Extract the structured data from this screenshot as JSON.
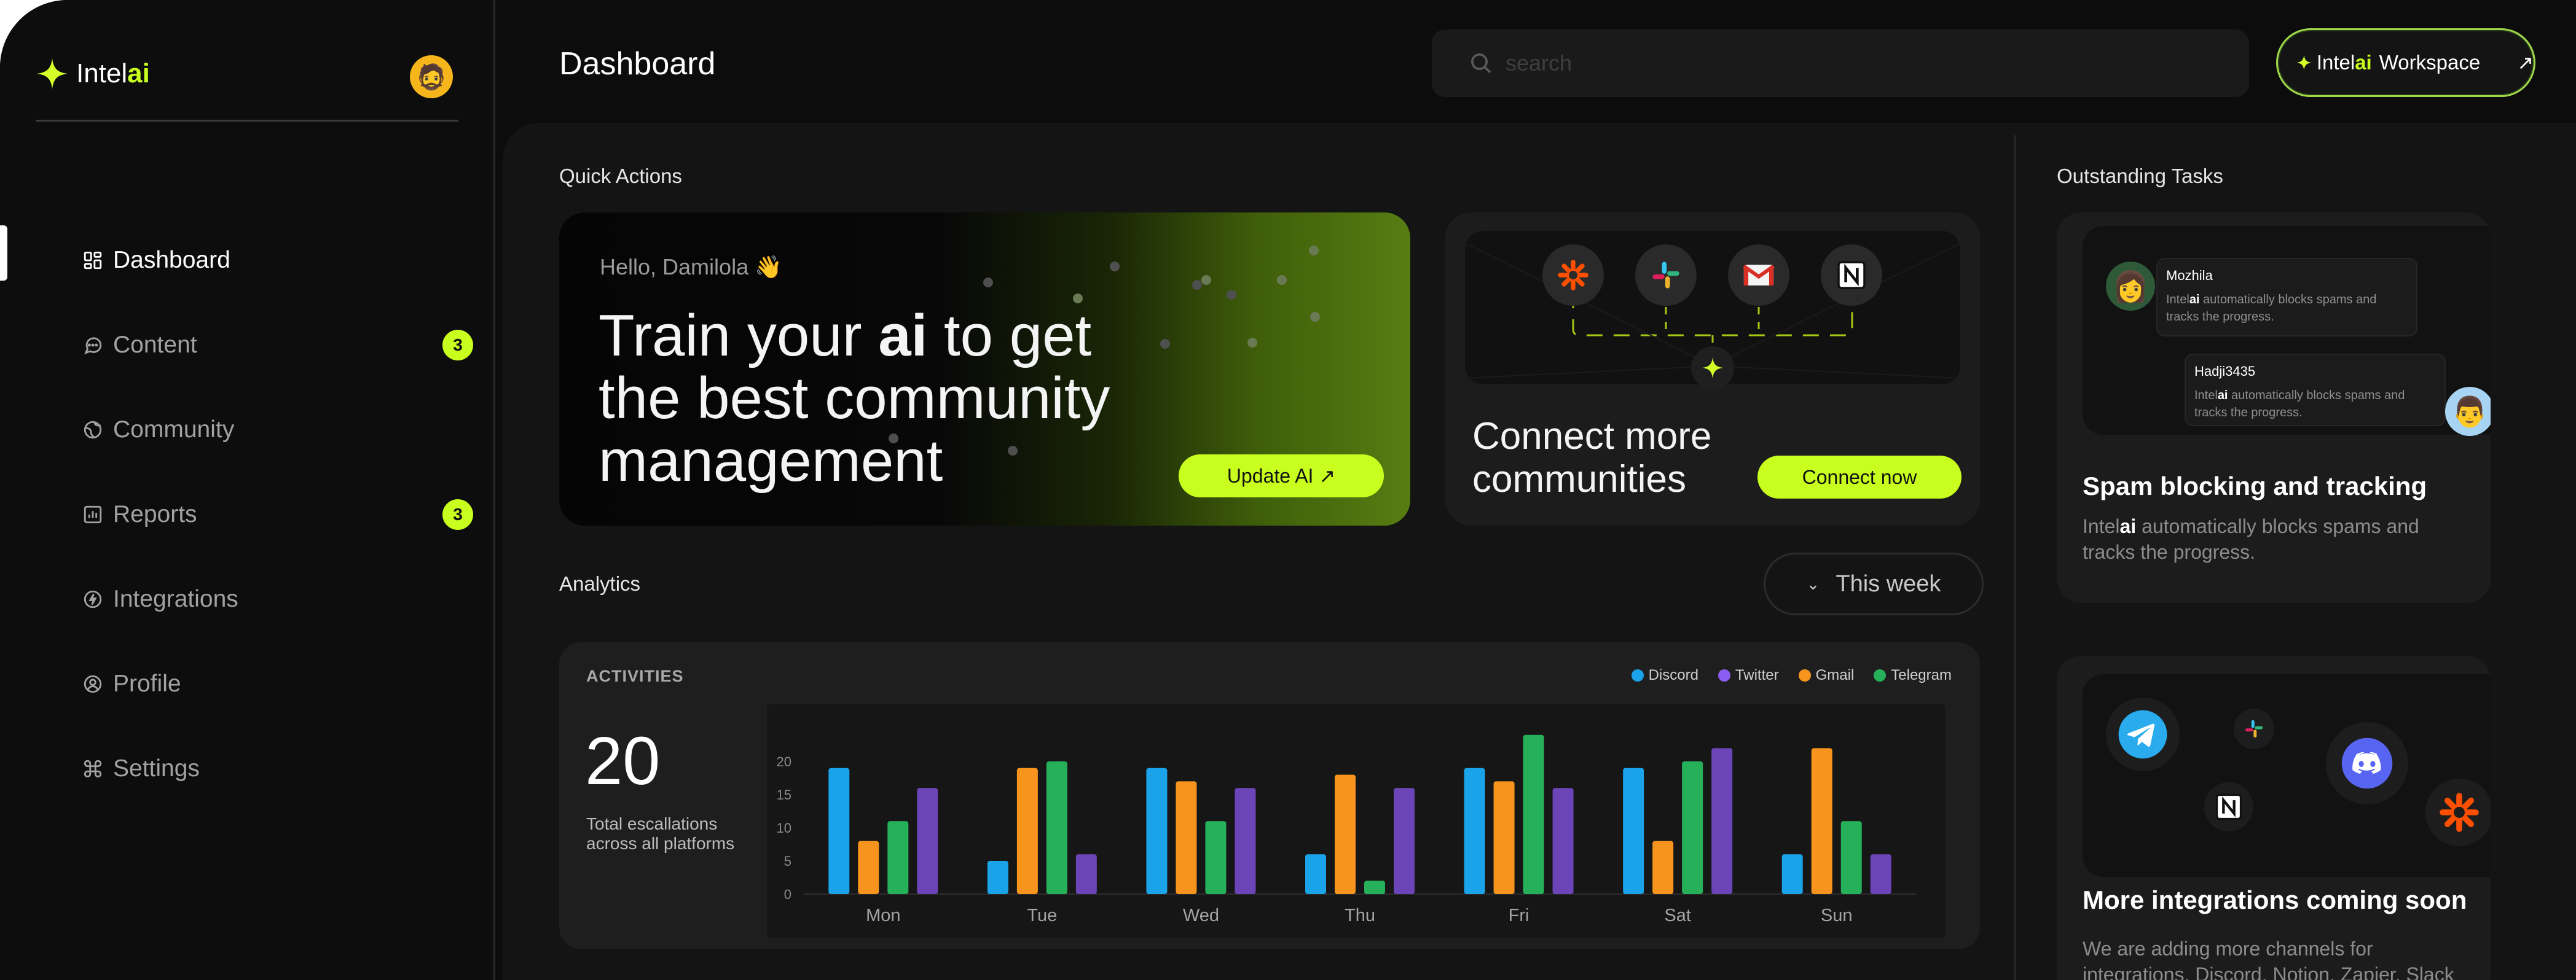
{
  "app": {
    "name_prefix": "Intel",
    "name_suffix": "ai"
  },
  "header": {
    "title": "Dashboard",
    "search_placeholder": "search",
    "workspace": {
      "prefix": "Intel",
      "suffix": "ai",
      "label": "Workspace",
      "arrow": "↗"
    }
  },
  "sidebar": {
    "items": [
      {
        "label": "Dashboard",
        "icon": "grid-icon",
        "active": true
      },
      {
        "label": "Content",
        "icon": "chat-icon",
        "badge": "3"
      },
      {
        "label": "Community",
        "icon": "globe-icon"
      },
      {
        "label": "Reports",
        "icon": "bar-chart-icon",
        "badge": "3"
      },
      {
        "label": "Integrations",
        "icon": "bolt-icon"
      },
      {
        "label": "Profile",
        "icon": "user-icon"
      },
      {
        "label": "Settings",
        "icon": "command-icon"
      }
    ]
  },
  "quick_actions": {
    "title": "Quick Actions",
    "hero": {
      "greeting": "Hello, Damilola 👋",
      "line1_pre": "Train your ",
      "line1_bold": "ai",
      "line1_post": " to get",
      "line2": "the best community",
      "line3": "management",
      "button": "Update AI ↗"
    },
    "connect": {
      "title_line1": "Connect more",
      "title_line2": "communities",
      "button": "Connect now",
      "apps": [
        "zapier-icon",
        "slack-icon",
        "gmail-icon",
        "notion-icon"
      ]
    }
  },
  "analytics": {
    "title": "Analytics",
    "period": "This week",
    "card_label": "ACTIVITIES",
    "total": "20",
    "total_desc": "Total escallations across all platforms"
  },
  "chart_data": {
    "type": "bar",
    "categories": [
      "Mon",
      "Tue",
      "Wed",
      "Thu",
      "Fri",
      "Sat",
      "Sun"
    ],
    "series": [
      {
        "name": "Discord",
        "color": "#1aa3e8",
        "values": [
          19,
          5,
          19,
          6,
          19,
          19,
          6
        ]
      },
      {
        "name": "Twitter",
        "color": "#f7941d",
        "values": [
          8,
          19,
          17,
          18,
          17,
          8,
          22
        ]
      },
      {
        "name": "Gmail",
        "color": "#27b05a",
        "values": [
          11,
          20,
          11,
          2,
          24,
          20,
          11
        ]
      },
      {
        "name": "Telegram",
        "color": "#6b45b8",
        "values": [
          16,
          6,
          16,
          16,
          16,
          22,
          6
        ]
      }
    ],
    "yticks": [
      0,
      5,
      10,
      15,
      20
    ],
    "ylim": [
      0,
      25
    ],
    "legend_order": [
      "Discord",
      "Twitter",
      "Gmail",
      "Telegram"
    ],
    "legend_colors": [
      "#1aa3e8",
      "#8c5cf0",
      "#f7941d",
      "#27b05a"
    ],
    "legend_position": "top-right",
    "grid": false
  },
  "tasks": {
    "title": "Outstanding Tasks",
    "spam_card": {
      "messages": [
        {
          "user": "Mozhila",
          "pre": "Intel",
          "bold": "ai",
          "post": " automatically blocks spams and tracks the progress."
        },
        {
          "user": "Hadji3435",
          "pre": "Intel",
          "bold": "ai",
          "post": " automatically blocks spams and tracks the progress."
        }
      ],
      "title": "Spam blocking and tracking",
      "desc_pre": "Intel",
      "desc_bold": "ai",
      "desc_post": "  automatically blocks spams and tracks the progress."
    },
    "integrations_card": {
      "title": "More integrations coming soon",
      "desc": "We are adding more channels for integrations, Discord, Notion, Zapier, Slack",
      "apps": [
        "telegram-icon",
        "slack-icon",
        "discord-icon",
        "notion-icon",
        "zapier-icon"
      ]
    }
  },
  "colors": {
    "accent": "#c8ff1e",
    "background": "#0c0c0c",
    "panel": "#141414",
    "card": "#1e1e1e"
  }
}
